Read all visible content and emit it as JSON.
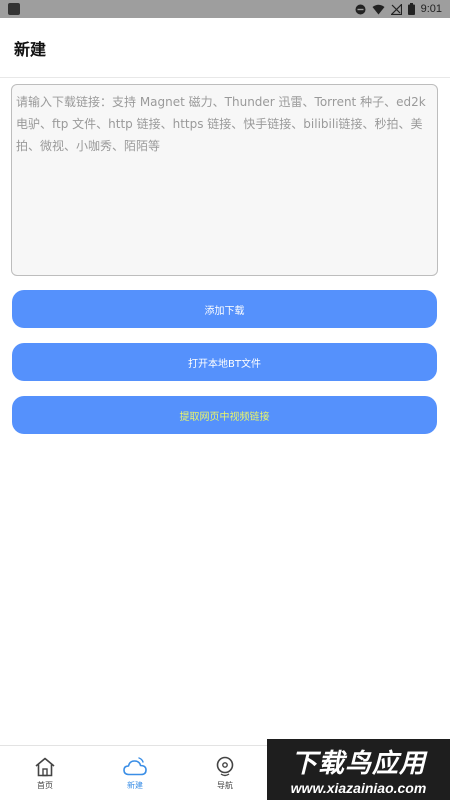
{
  "status_bar": {
    "time": "9:01"
  },
  "header": {
    "title": "新建"
  },
  "input": {
    "placeholder": "请输入下载链接：支持 Magnet 磁力、Thunder 迅雷、Torrent 种子、ed2k 电驴、ftp 文件、http 链接、https 链接、快手链接、bilibili链接、秒拍、美拍、微视、小咖秀、陌陌等"
  },
  "buttons": {
    "add_download": "添加下载",
    "open_bt": "打开本地BT文件",
    "extract_video": "提取网页中视频链接"
  },
  "bottom_nav": {
    "items": [
      {
        "label": "首页",
        "icon": "home-icon",
        "active": false
      },
      {
        "label": "新建",
        "icon": "cloud-icon",
        "active": true
      },
      {
        "label": "导航",
        "icon": "compass-icon",
        "active": false
      }
    ]
  },
  "watermark": {
    "title": "下载鸟应用",
    "url": "www.xiazainiao.com"
  },
  "colors": {
    "accent": "#5591fc",
    "active_nav": "#3a8ee6",
    "extract_text": "#e9f56a"
  }
}
